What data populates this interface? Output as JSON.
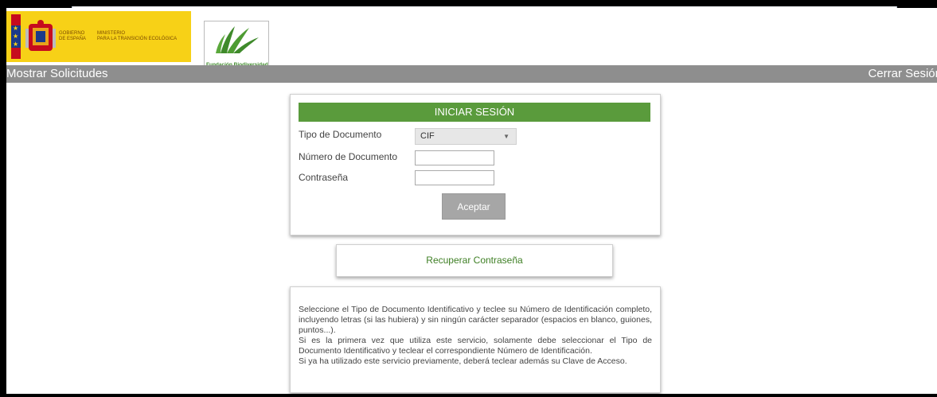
{
  "header": {
    "gov_logo": {
      "flag_alt": "Bandera de España",
      "gov_line1": "GOBIERNO",
      "gov_line2": "DE ESPAÑA",
      "ministry_line1": "MINISTERIO",
      "ministry_line2": "PARA LA TRANSICIÓN ECOLÓGICA"
    },
    "fb_logo_caption": "Fundación Biodiversidad"
  },
  "navbar": {
    "left_link": "Mostrar Solicitudes",
    "right_link": "Cerrar Sesión"
  },
  "login": {
    "title": "INICIAR SESIÓN",
    "doc_type_label": "Tipo de Documento",
    "doc_type_value": "CIF",
    "doc_number_label": "Número de Documento",
    "doc_number_value": "",
    "password_label": "Contraseña",
    "password_value": "",
    "submit_label": "Aceptar"
  },
  "recover": {
    "label": "Recuperar Contraseña"
  },
  "info": {
    "paragraph1": "Seleccione el Tipo de Documento Identificativo y teclee su Número de Identificación completo, incluyendo letras (si las hubiera) y sin ningún carácter separador (espacios en blanco, guiones, puntos...).",
    "paragraph2": "Si es la primera vez que utiliza este servicio, solamente debe seleccionar el Tipo de Documento Identificativo y teclear el correspondiente Número de Identificación.",
    "paragraph3": "Si ya ha utilizado este servicio previamente, deberá teclear además su Clave de Acceso."
  },
  "colors": {
    "brand_green": "#5a9b3c",
    "link_green": "#3e7f24",
    "navbar_gray": "#8e8e8e",
    "gov_yellow": "#f7d117"
  },
  "icons": {
    "select_caret": "chevron-down-icon"
  }
}
